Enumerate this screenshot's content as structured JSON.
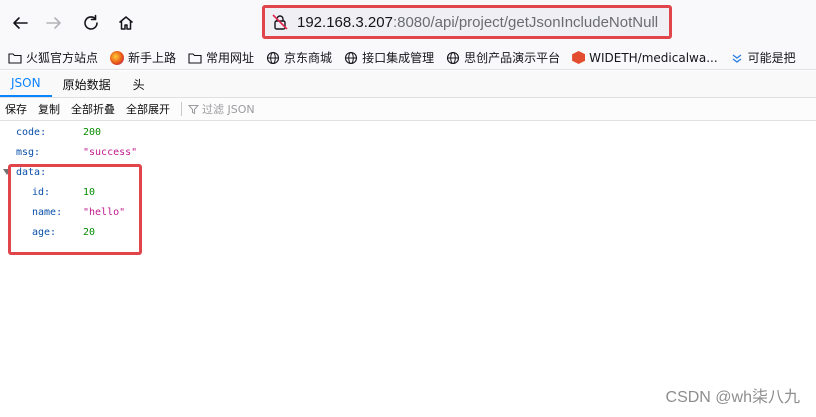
{
  "browser": {
    "url_host": "192.168.3.207",
    "url_rest": ":8080/api/project/getJsonIncludeNotNull"
  },
  "bookmarks": [
    {
      "label": "火狐官方站点",
      "icon": "folder-icon"
    },
    {
      "label": "新手上路",
      "icon": "firefox-icon"
    },
    {
      "label": "常用网址",
      "icon": "folder-icon"
    },
    {
      "label": "京东商城",
      "icon": "globe-icon"
    },
    {
      "label": "接口集成管理",
      "icon": "globe-icon"
    },
    {
      "label": "思创产品演示平台",
      "icon": "globe-icon"
    },
    {
      "label": "WIDETH/medicalwa...",
      "icon": "hexagon-icon"
    },
    {
      "label": "可能是把",
      "icon": "chevron-icon"
    }
  ],
  "viewer": {
    "tabs": [
      "JSON",
      "原始数据",
      "头"
    ],
    "actions": [
      "保存",
      "复制",
      "全部折叠",
      "全部展开"
    ],
    "filter_placeholder": "过滤 JSON"
  },
  "json": {
    "code_key": "code:",
    "code_value": "200",
    "msg_key": "msg:",
    "msg_value": "\"success\"",
    "data_key": "data:",
    "id_key": "id:",
    "id_value": "10",
    "name_key": "name:",
    "name_value": "\"hello\"",
    "age_key": "age:",
    "age_value": "20"
  },
  "watermark": "CSDN @wh柒八九",
  "colors": {
    "highlight": "#e0454b",
    "active_tab": "#0a84ff",
    "key": "#0a4fa8",
    "number": "#058b00",
    "string": "#c2188c"
  }
}
